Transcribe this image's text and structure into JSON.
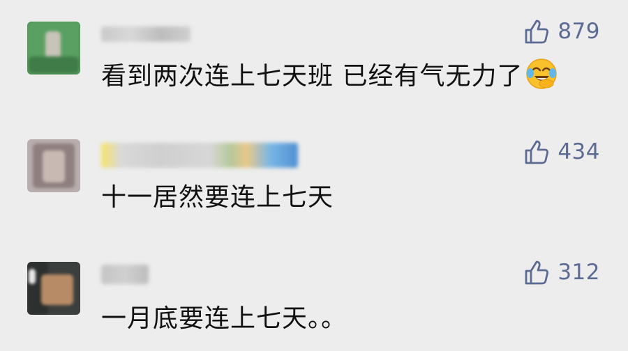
{
  "comments": [
    {
      "likes": "879",
      "text": "看到两次连上七天班 已经有气无力了",
      "emoji_name": "laughing-crying-face-icon"
    },
    {
      "likes": "434",
      "text": "十一居然要连上七天"
    },
    {
      "likes": "312",
      "text": "一月底要连上七天。。"
    }
  ],
  "colors": {
    "background": "#ededed",
    "like_color": "#5b6b93",
    "text_color": "#111111"
  },
  "icons": [
    "thumbs-up-icon",
    "laughing-crying-face-icon"
  ]
}
